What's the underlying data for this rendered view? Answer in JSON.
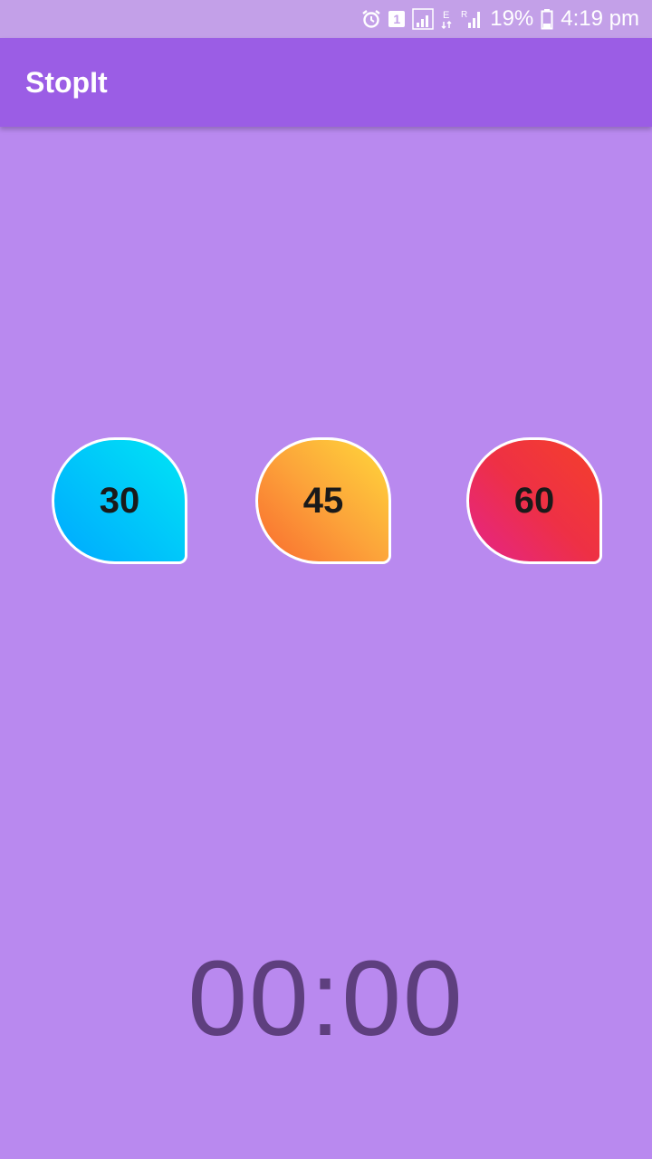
{
  "status_bar": {
    "battery_percent": "19%",
    "time": "4:19 pm",
    "sim_badge": "1",
    "icons": [
      "alarm-icon",
      "sim-icon",
      "signal-icon",
      "data-e-icon",
      "signal-r-icon",
      "battery-icon"
    ]
  },
  "app_bar": {
    "title": "StopIt",
    "color": "#9b5de5"
  },
  "timer_buttons": [
    {
      "label": "30"
    },
    {
      "label": "45"
    },
    {
      "label": "60"
    }
  ],
  "clock": {
    "display": "00:00"
  },
  "colors": {
    "background": "#b989ef",
    "clock_text": "#5e3f7e"
  }
}
